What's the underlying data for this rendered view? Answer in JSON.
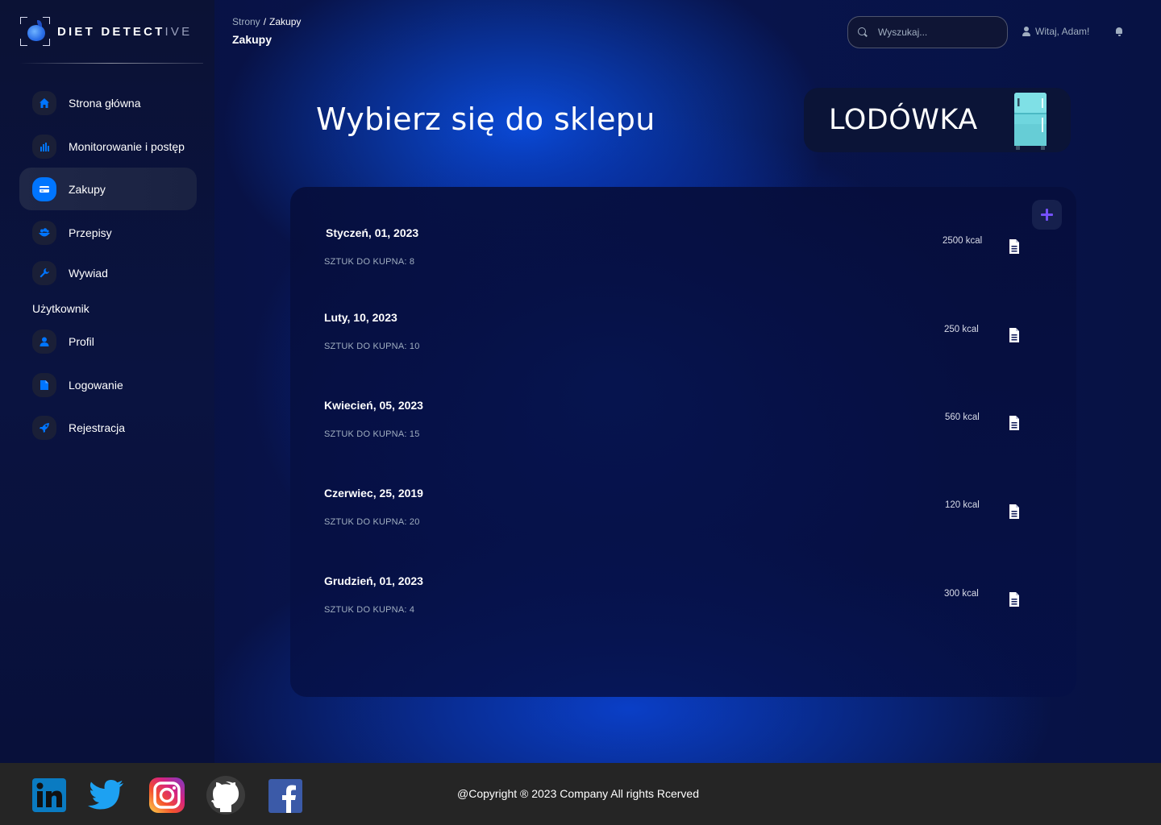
{
  "brand": {
    "name_bold": "DIET DETECT",
    "name_fade": "IVE"
  },
  "sidebar": {
    "items": [
      {
        "label": "Strona główna",
        "icon": "home-icon"
      },
      {
        "label": "Monitorowanie i postęp",
        "icon": "chart-icon"
      },
      {
        "label": "Zakupy",
        "icon": "credit-card-icon",
        "active": true
      },
      {
        "label": "Przepisy",
        "icon": "recipes-icon"
      },
      {
        "label": "Wywiad",
        "icon": "wrench-icon"
      }
    ],
    "section_title": "Użytkownik",
    "user_items": [
      {
        "label": "Profil",
        "icon": "person-icon"
      },
      {
        "label": "Logowanie",
        "icon": "document-icon"
      },
      {
        "label": "Rejestracja",
        "icon": "rocket-icon"
      }
    ]
  },
  "header": {
    "breadcrumb_root": "Strony",
    "breadcrumb_sep": "/",
    "breadcrumb_current": "Zakupy",
    "page_title": "Zakupy",
    "search_placeholder": "Wyszukaj...",
    "greeting": "Witaj, Adam!"
  },
  "hero": {
    "title": "Wybierz się do sklepu"
  },
  "fridge": {
    "label": "LODÓWKA"
  },
  "shopping_lists": [
    {
      "date": "Styczeń, 01, 2023",
      "count": "SZTUK DO KUPNA: 8",
      "kcal": "2500 kcal"
    },
    {
      "date": "Luty, 10, 2023",
      "count": "SZTUK DO KUPNA: 10",
      "kcal": "250 kcal"
    },
    {
      "date": "Kwiecień, 05, 2023",
      "count": "SZTUK DO KUPNA: 15",
      "kcal": "560 kcal"
    },
    {
      "date": "Czerwiec, 25, 2019",
      "count": "SZTUK DO KUPNA: 20",
      "kcal": "120 kcal"
    },
    {
      "date": "Grudzień, 01, 2023",
      "count": "SZTUK DO KUPNA: 4",
      "kcal": "300 kcal"
    }
  ],
  "footer": {
    "socials": [
      "linkedin-icon",
      "twitter-icon",
      "instagram-icon",
      "github-icon",
      "facebook-icon"
    ],
    "copyright": "@Copyright ® 2023 Company All rights Rcerved"
  },
  "colors": {
    "accent": "#0075ff",
    "add_button": "#7551ff",
    "footer_bg": "#252525"
  }
}
